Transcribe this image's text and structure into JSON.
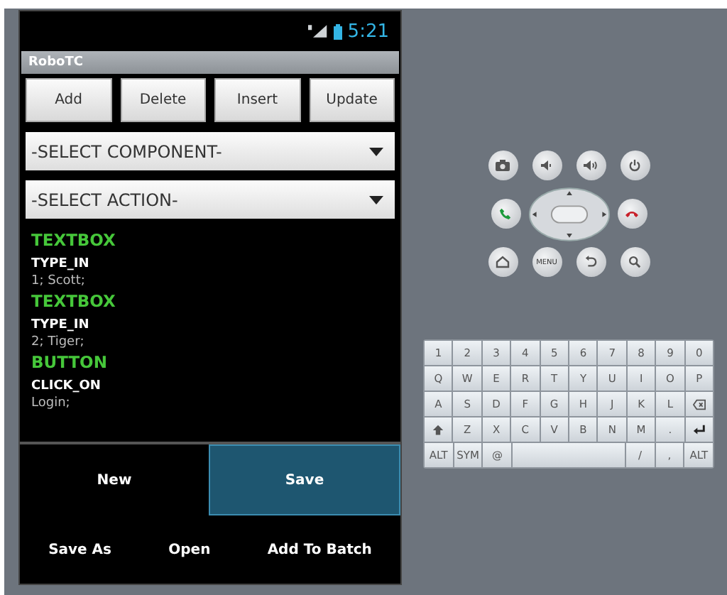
{
  "status_bar": {
    "time": "5:21"
  },
  "app": {
    "title": "RoboTC"
  },
  "buttons": [
    "Add",
    "Delete",
    "Insert",
    "Update"
  ],
  "spinners": [
    {
      "value": "-SELECT COMPONENT-"
    },
    {
      "value": "-SELECT ACTION-"
    }
  ],
  "steps": [
    {
      "component": "TEXTBOX",
      "action": "TYPE_IN",
      "params": "1; Scott;"
    },
    {
      "component": "TEXTBOX",
      "action": "TYPE_IN",
      "params": "2; Tiger;"
    },
    {
      "component": "BUTTON",
      "action": "CLICK_ON",
      "params": "Login;"
    }
  ],
  "tabs": [
    {
      "label": "New",
      "selected": false
    },
    {
      "label": "Save",
      "selected": true
    }
  ],
  "menu": [
    "Save As",
    "Open",
    "Add To Batch"
  ],
  "hardware_keys": {
    "menu_label": "MENU"
  },
  "keyboard": [
    [
      {
        "kind": "text",
        "label": "1"
      },
      {
        "kind": "text",
        "label": "2"
      },
      {
        "kind": "text",
        "label": "3"
      },
      {
        "kind": "text",
        "label": "4"
      },
      {
        "kind": "text",
        "label": "5"
      },
      {
        "kind": "text",
        "label": "6"
      },
      {
        "kind": "text",
        "label": "7"
      },
      {
        "kind": "text",
        "label": "8"
      },
      {
        "kind": "text",
        "label": "9"
      },
      {
        "kind": "text",
        "label": "0"
      }
    ],
    [
      {
        "kind": "text",
        "label": "Q"
      },
      {
        "kind": "text",
        "label": "W"
      },
      {
        "kind": "text",
        "label": "E"
      },
      {
        "kind": "text",
        "label": "R"
      },
      {
        "kind": "text",
        "label": "T"
      },
      {
        "kind": "text",
        "label": "Y"
      },
      {
        "kind": "text",
        "label": "U"
      },
      {
        "kind": "text",
        "label": "I"
      },
      {
        "kind": "text",
        "label": "O"
      },
      {
        "kind": "text",
        "label": "P"
      }
    ],
    [
      {
        "kind": "text",
        "label": "A"
      },
      {
        "kind": "text",
        "label": "S"
      },
      {
        "kind": "text",
        "label": "D"
      },
      {
        "kind": "text",
        "label": "F"
      },
      {
        "kind": "text",
        "label": "G"
      },
      {
        "kind": "text",
        "label": "H"
      },
      {
        "kind": "text",
        "label": "J"
      },
      {
        "kind": "text",
        "label": "K"
      },
      {
        "kind": "text",
        "label": "L"
      },
      {
        "kind": "delete"
      }
    ],
    [
      {
        "kind": "shift"
      },
      {
        "kind": "text",
        "label": "Z"
      },
      {
        "kind": "text",
        "label": "X"
      },
      {
        "kind": "text",
        "label": "C"
      },
      {
        "kind": "text",
        "label": "V"
      },
      {
        "kind": "text",
        "label": "B"
      },
      {
        "kind": "text",
        "label": "N"
      },
      {
        "kind": "text",
        "label": "M"
      },
      {
        "kind": "text",
        "label": "."
      },
      {
        "kind": "enter"
      }
    ],
    [
      {
        "kind": "text",
        "label": "ALT"
      },
      {
        "kind": "text",
        "label": "SYM"
      },
      {
        "kind": "text",
        "label": "@"
      },
      {
        "kind": "space"
      },
      {
        "kind": "text",
        "label": "/"
      },
      {
        "kind": "text",
        "label": ","
      },
      {
        "kind": "text",
        "label": "ALT"
      }
    ]
  ]
}
